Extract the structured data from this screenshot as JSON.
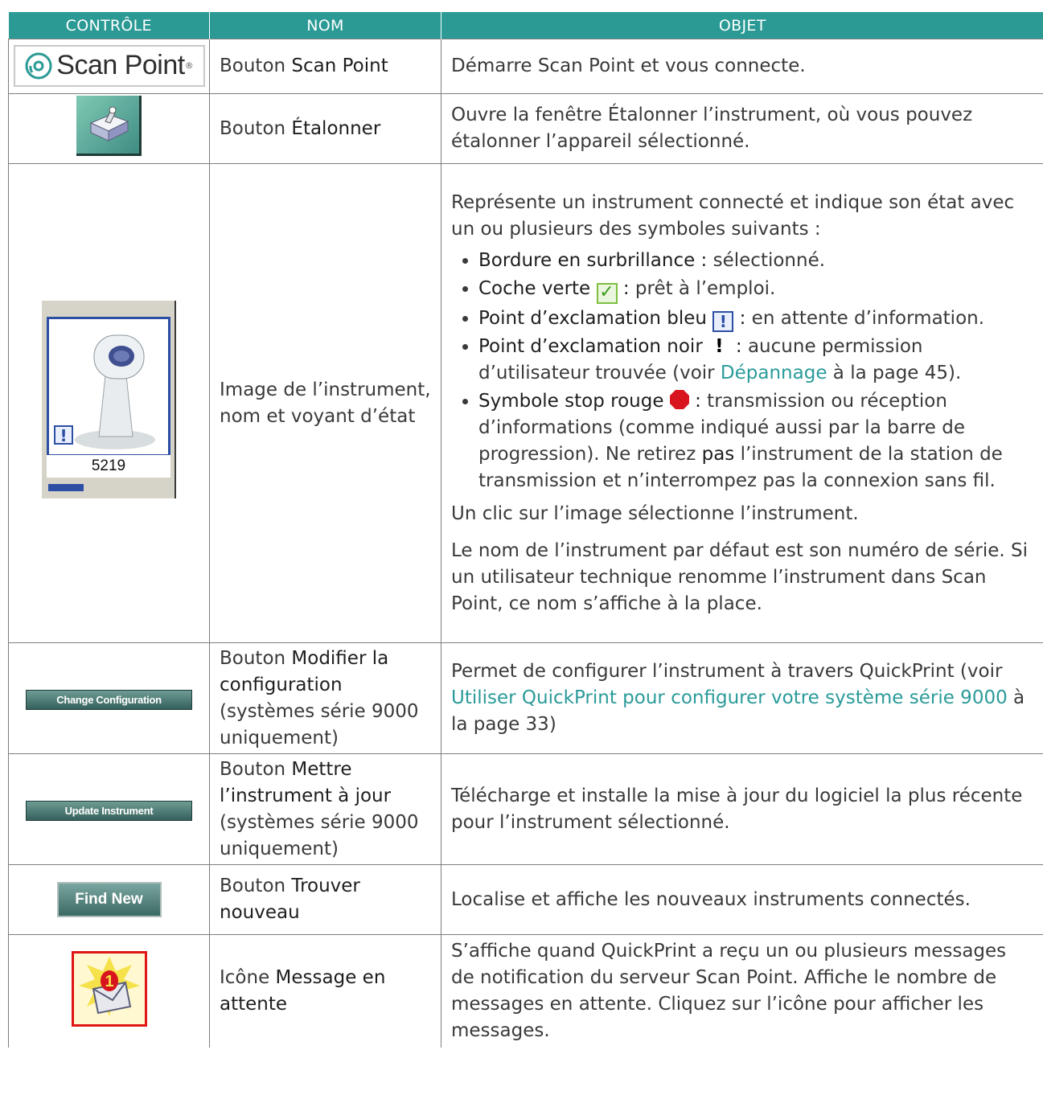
{
  "headers": {
    "control": "CONTRÔLE",
    "name": "NOM",
    "purpose": "OBJET"
  },
  "rows": {
    "scanpoint": {
      "control_logo": "Scan Point",
      "name_prefix": "Bouton ",
      "name_bold": "Scan Point",
      "purpose": "Démarre Scan Point et vous connecte."
    },
    "calibrate": {
      "name_prefix": "Bouton ",
      "name_bold": "Étalonner",
      "purpose": "Ouvre la fenêtre Étalonner l’instrument, où vous pouvez étalonner l’appareil sélectionné."
    },
    "instrument": {
      "serial": "5219",
      "name": "Image de l’instrument, nom et voyant d’état",
      "intro": "Représente un instrument connecté et indique son état avec un ou plusieurs des symboles suivants :",
      "b1_label": "Bordure en surbrillance :",
      "b1_text": " sélectionné.",
      "b2_label": "Coche verte",
      "b2_sep": " :",
      "b2_text": " prêt à l’emploi.",
      "b3_label": "Point d’exclamation bleu",
      "b3_sep": " :",
      "b3_text": " en attente d’information.",
      "b4_label": "Point d’exclamation noir",
      "b4_sep": " :",
      "b4_text": " aucune permission d’utilisateur trouvée (voir ",
      "b4_link": "Dépannage",
      "b4_after": " à la page 45).",
      "b5_label": "Symbole stop rouge",
      "b5_sep": " :",
      "b5_text": " transmission ou réception d’informations (comme indiqué aussi par la barre de progression). Ne retirez ",
      "b5_bold": "pas",
      "b5_after": " l’instrument de la station de transmission et n’interrompez pas la connexion sans fil.",
      "p2": "Un clic sur l’image sélectionne l’instrument.",
      "p3": "Le nom de l’instrument par défaut est son numéro de série. Si un utilisateur technique renomme l’instrument dans Scan Point, ce nom s’affiche à la place."
    },
    "change_config": {
      "button": "Change Configuration",
      "name_prefix": "Bouton ",
      "name_bold": "Modifier la configuration",
      "name_suffix": " (systèmes série 9000 uniquement)",
      "purpose_pre": "Permet de configurer l’instrument à travers QuickPrint (voir ",
      "purpose_link": "Utiliser QuickPrint pour configurer votre système série 9000",
      "purpose_after": " à la page 33)"
    },
    "update": {
      "button": "Update Instrument",
      "name_prefix": "Bouton ",
      "name_bold": "Mettre l’instrument à jour",
      "name_suffix": " (systèmes série 9000 uniquement)",
      "purpose": "Télécharge et installe la mise à jour du logiciel la plus récente pour l’instrument sélectionné."
    },
    "find_new": {
      "button": "Find New",
      "name_prefix": "Bouton ",
      "name_bold": "Trouver nouveau",
      "purpose": "Localise et affiche les nouveaux instruments connectés."
    },
    "message": {
      "name_prefix": "Icône ",
      "name_bold": "Message en attente",
      "purpose": "S’affiche quand QuickPrint a reçu un ou plusieurs messages de notification du serveur Scan Point. Affiche le nombre de messages en attente. Cliquez sur l’icône pour afficher les messages."
    }
  },
  "colors": {
    "header_bg": "#2b9a95",
    "link": "#2a9b9a",
    "border": "#7d7d7d"
  }
}
